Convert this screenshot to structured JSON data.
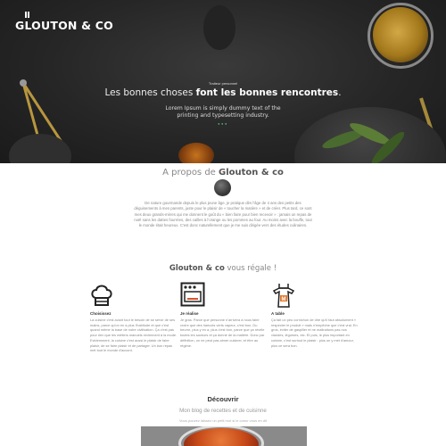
{
  "header": {
    "logo_text": "GLOUTON & CO"
  },
  "hero": {
    "kicker": "Traiteur personnel",
    "title_plain": "Les bonnes choses ",
    "title_bold": "font les bonnes rencontres",
    "title_end": ".",
    "subtitle": "Lorem Ipsum is simply dummy text of the printing and typesetting industry.",
    "dots": "●●●"
  },
  "about": {
    "title_plain": "A propos de ",
    "title_bold": "Glouton & co",
    "text": "De nature gourmande depuis le plus jeune âge, je pratique dès l'âge de 4 ans des petits des déguisements à mes parents, juste pour le plaisir de « toucher la matière » et de créer. Plus tard, ce sont mes deux grands-mères qui me donnent le goût du « bien faire pour bien recevoir » : jamais un repas de noël sans les dattes fourrées, des cailles à l'orange ou les pommes au four. Au moins avec la bouffe, tout le monde était heureux. C'est donc naturellement que je me suis dirigée vers des études culinaires."
  },
  "services": {
    "title_bold": "Glouton & co",
    "title_plain": " vous régale !",
    "items": [
      {
        "name": "Choisissez",
        "icon": "chef-hat-icon",
        "text": "La cuisine c'est avant tout le besoin de se servir de ses mains, parce qu'on en a plus l'habitude et que c'est quand même la base de notre civilisation. Ça c'est pas pour rien que les métiers manuels reviennent à la mode. Evidemment, la cuisine c'est aussi le plaisir de faire plaisir, de se faire plaisir et de partager. Un bon repas met tout le monde d'accord."
      },
      {
        "name": "Je réalise",
        "icon": "oven-icon",
        "text": "Je gras. Parce que personne n'arrivera à nous faire croire que des haricots verts vapeur, c'est bon. Du beurre, plus y en a, plus c'est bon, parce que ça révèle toutes les saveurs et ça donne de la matière. Donc par définition, on ne peut pas aimer cuisiner, et être au régime."
      },
      {
        "name": "A table",
        "icon": "apron-icon",
        "text": "Ça fait un peu cornichon de dire qu'il faut absolument « respecter le produit » mais n'empêche que c'est vrai. En gros, éviter de gaspiller et ne maltraitons pas nos viandes, légumes, etc. Et puis, le plus important en cuisine, c'est surtout le plaisir : plus on y met d'amour, plus ce sera bon."
      }
    ]
  },
  "discover": {
    "title": "Découvrir",
    "subtitle": "Mon blog de recettes et de cuisinne",
    "hint": "Vous pouvez laissez un petit mot si le coeur vous en dit"
  },
  "colors": {
    "accent_green": "#4fb07d",
    "oven_red": "#d9532c",
    "apron_orange": "#e07b2e"
  }
}
